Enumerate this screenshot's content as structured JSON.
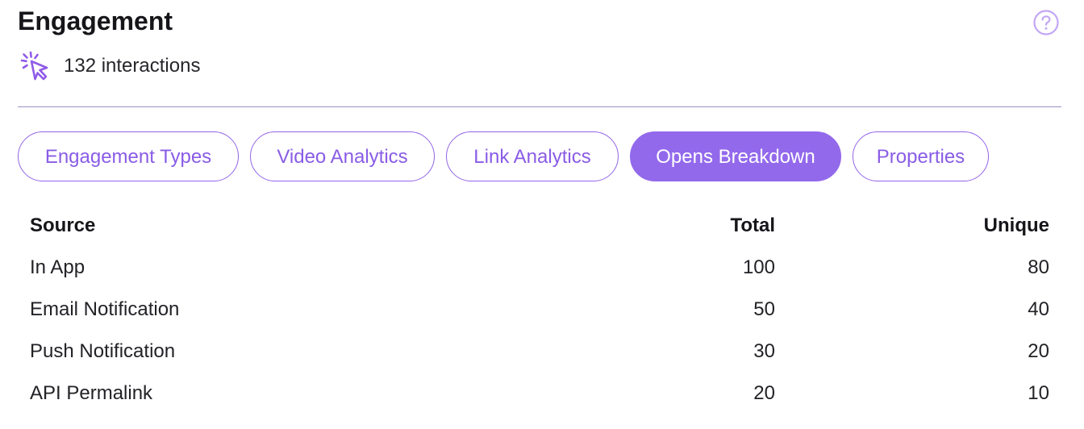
{
  "header": {
    "title": "Engagement",
    "help_icon": "question-circle-icon",
    "accent_color": "#9369ec"
  },
  "stats": {
    "icon": "cursor-click-icon",
    "interactions_label": "132 interactions"
  },
  "tabs": [
    {
      "label": "Engagement Types",
      "active": false
    },
    {
      "label": "Video Analytics",
      "active": false
    },
    {
      "label": "Link Analytics",
      "active": false
    },
    {
      "label": "Opens Breakdown",
      "active": true
    },
    {
      "label": "Properties",
      "active": false
    }
  ],
  "table": {
    "headers": [
      "Source",
      "Total",
      "Unique"
    ],
    "rows": [
      [
        "In App",
        "100",
        "80"
      ],
      [
        "Email Notification",
        "50",
        "40"
      ],
      [
        "Push Notification",
        "30",
        "20"
      ],
      [
        "API Permalink",
        "20",
        "10"
      ]
    ]
  }
}
